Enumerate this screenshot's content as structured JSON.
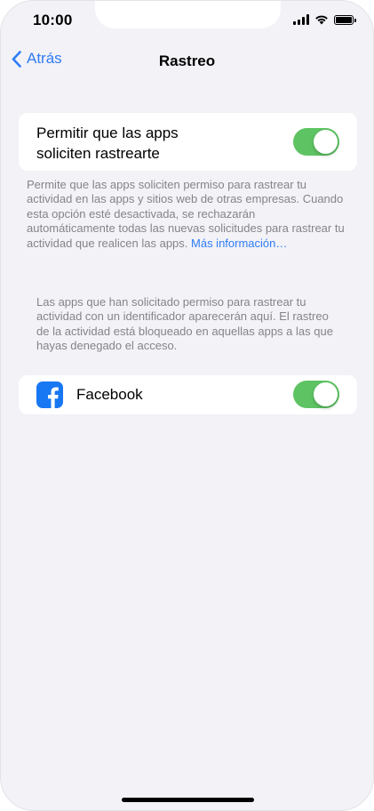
{
  "status_bar": {
    "time": "10:00"
  },
  "nav": {
    "back_label": "Atrás",
    "title": "Rastreo"
  },
  "allow_tracking": {
    "label_line1": "Permitir que las apps",
    "label_line2": "soliciten rastrearte",
    "toggle_on": true
  },
  "footnote_1": {
    "text": "Permite que las apps soliciten permiso para rastrear tu actividad en las apps y sitios web de otras empresas. Cuando esta opción esté desactivada, se rechazarán automáticamente todas las nuevas solicitudes para rastrear tu actividad que realicen las apps.",
    "link": "Más información…"
  },
  "footnote_2": {
    "text": "Las apps que han solicitado permiso para rastrear tu actividad con un identificador aparecerán aquí. El rastreo de la actividad está bloqueado en aquellas apps a las que hayas denegado el acceso."
  },
  "apps": [
    {
      "name": "Facebook",
      "icon": "facebook-icon",
      "toggle_on": true
    }
  ],
  "colors": {
    "accent": "#2f7cf6",
    "toggle_on": "#5ec463",
    "background": "#f2f2f7",
    "facebook_blue": "#1877f2"
  }
}
